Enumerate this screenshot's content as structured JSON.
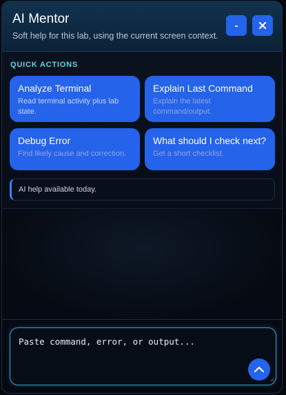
{
  "header": {
    "title": "AI Mentor",
    "subtitle": "Soft help for this lab, using the current screen context.",
    "minimize_label": "-",
    "close_label": "×"
  },
  "quick_actions": {
    "label": "QUICK ACTIONS",
    "items": [
      {
        "title": "Analyze Terminal",
        "description": "Read terminal activity plus lab state."
      },
      {
        "title": "Explain Last Command",
        "description": "Explain the latest command/output."
      },
      {
        "title": "Debug Error",
        "description": "Find likely cause and correction."
      },
      {
        "title": "What should I check next?",
        "description": "Get a short checklist."
      }
    ]
  },
  "status": {
    "text": "AI help available today."
  },
  "composer": {
    "placeholder": "Paste command, error, or output...",
    "send_icon": "chevron-up-icon"
  },
  "colors": {
    "accent": "#2563eb",
    "section_label": "#5ed6e6",
    "input_border": "#3aa0c8"
  }
}
